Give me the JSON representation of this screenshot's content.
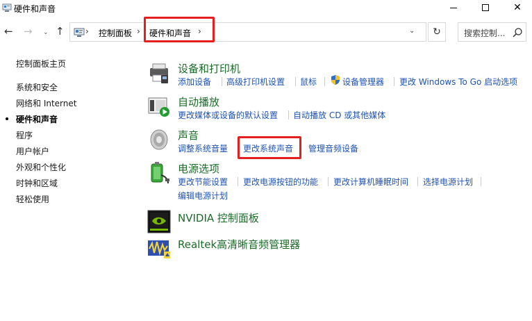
{
  "window": {
    "title": "硬件和声音",
    "min_glyph": "",
    "max_glyph": "",
    "close_glyph": "✕"
  },
  "nav": {
    "back": "←",
    "forward": "→",
    "recent": "⌄",
    "up": "↑"
  },
  "address": {
    "sep": "›",
    "crumbs": [
      "控制面板",
      "硬件和声音"
    ],
    "dropdown": "⌄",
    "refresh": "↻"
  },
  "search": {
    "placeholder": "搜索控制..."
  },
  "sidebar": {
    "home": "控制面板主页",
    "items": [
      "系统和安全",
      "网络和 Internet",
      "硬件和声音",
      "程序",
      "用户帐户",
      "外观和个性化",
      "时钟和区域",
      "轻松使用"
    ],
    "active_index": 2
  },
  "categories": [
    {
      "title": "设备和打印机",
      "links": [
        "添加设备",
        "高级打印机设置",
        "鼠标",
        "设备管理器",
        "更改 Windows To Go 启动选项"
      ]
    },
    {
      "title": "自动播放",
      "links": [
        "更改媒体或设备的默认设置",
        "自动播放 CD 或其他媒体"
      ]
    },
    {
      "title": "声音",
      "links": [
        "调整系统音量",
        "更改系统声音",
        "管理音频设备"
      ]
    },
    {
      "title": "电源选项",
      "links": [
        "更改节能设置",
        "更改电源按钮的功能",
        "更改计算机睡眠时间",
        "选择电源计划",
        "编辑电源计划"
      ]
    },
    {
      "title": "NVIDIA 控制面板",
      "links": []
    },
    {
      "title": "Realtek高清晰音频管理器",
      "links": []
    }
  ],
  "colors": {
    "category_title": "#1a6b28",
    "link": "#1f53b4",
    "highlight": "#e51f1f"
  },
  "icons": [
    "app-icon",
    "control-panel-icon",
    "search-icon",
    "printer-icon",
    "autoplay-icon",
    "speaker-icon",
    "power-icon",
    "nvidia-icon",
    "realtek-icon",
    "shield-icon"
  ]
}
